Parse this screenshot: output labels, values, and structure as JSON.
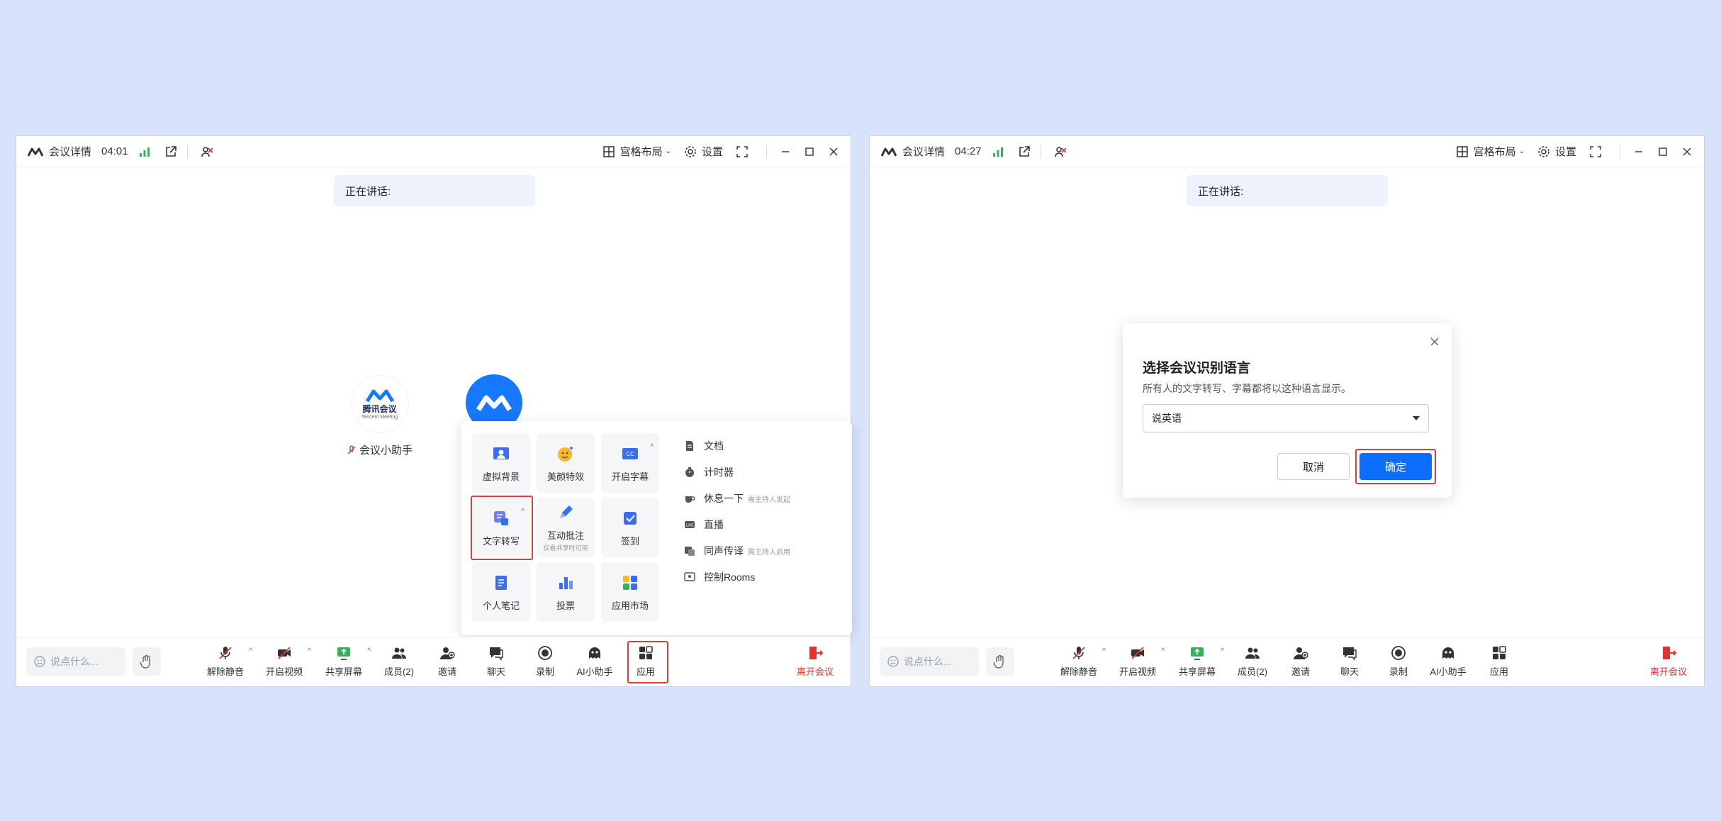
{
  "colors": {
    "page_bg": "#d6e3fb",
    "accent": "#0d6efd",
    "brand_blue": "#1678ff",
    "danger": "#e5322d",
    "highlight": "#e23b3b"
  },
  "left_window": {
    "title": {
      "meeting_details": "会议详情",
      "timer": "04:01",
      "layout": "宫格布局",
      "settings": "设置"
    },
    "speaking": "正在讲话:",
    "participants": [
      {
        "avatar_text": "腾讯会议",
        "avatar_sub": "Tencent Meeting",
        "name": "会议小助手"
      }
    ],
    "apps": {
      "tiles": [
        {
          "label": "虚拟背景",
          "sub": ""
        },
        {
          "label": "美颜特效",
          "sub": ""
        },
        {
          "label": "开启字幕",
          "sub": ""
        },
        {
          "label": "文字转写",
          "sub": ""
        },
        {
          "label": "互动批注",
          "sub": "仅看共享时可用"
        },
        {
          "label": "签到",
          "sub": ""
        },
        {
          "label": "个人笔记",
          "sub": ""
        },
        {
          "label": "投票",
          "sub": ""
        },
        {
          "label": "应用市场",
          "sub": ""
        }
      ],
      "list": [
        {
          "label": "文档",
          "hint": ""
        },
        {
          "label": "计时器",
          "hint": ""
        },
        {
          "label": "休息一下",
          "hint": "需主持人发起"
        },
        {
          "label": "直播",
          "hint": ""
        },
        {
          "label": "同声传译",
          "hint": "需主持人启用"
        },
        {
          "label": "控制Rooms",
          "hint": ""
        }
      ]
    }
  },
  "right_window": {
    "title": {
      "meeting_details": "会议详情",
      "timer": "04:27",
      "layout": "宫格布局",
      "settings": "设置"
    },
    "speaking": "正在讲话:",
    "dialog": {
      "title": "选择会议识别语言",
      "description": "所有人的文字转写、字幕都将以这种语言显示。",
      "selected_language": "说英语",
      "cancel": "取消",
      "confirm": "确定"
    }
  },
  "toolbar": {
    "chat_placeholder": "说点什么...",
    "unmute": "解除静音",
    "video": "开启视频",
    "share": "共享屏幕",
    "members": "成员(2)",
    "invite": "邀请",
    "chat": "聊天",
    "record": "录制",
    "ai": "AI小助手",
    "apps": "应用",
    "leave": "离开会议"
  }
}
